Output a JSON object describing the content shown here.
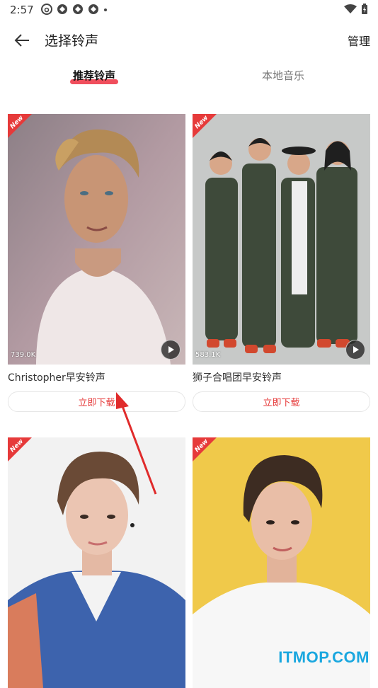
{
  "status": {
    "time": "2:57"
  },
  "header": {
    "title": "选择铃声",
    "manage": "管理"
  },
  "tabs": [
    {
      "label": "推荐铃声",
      "active": true
    },
    {
      "label": "本地音乐",
      "active": false
    }
  ],
  "cards": [
    {
      "badge": "New",
      "plays": "739.0K",
      "title": "Christopher早安铃声",
      "download": "立即下载"
    },
    {
      "badge": "New",
      "plays": "583.1K",
      "title": "狮子合唱团早安铃声",
      "download": "立即下载"
    },
    {
      "badge": "New",
      "plays": "",
      "title": "",
      "download": ""
    },
    {
      "badge": "New",
      "plays": "",
      "title": "",
      "download": ""
    }
  ],
  "watermark": "ITMOP.COM",
  "colors": {
    "accent": "#e63a3a",
    "watermark": "#1aa7df"
  }
}
